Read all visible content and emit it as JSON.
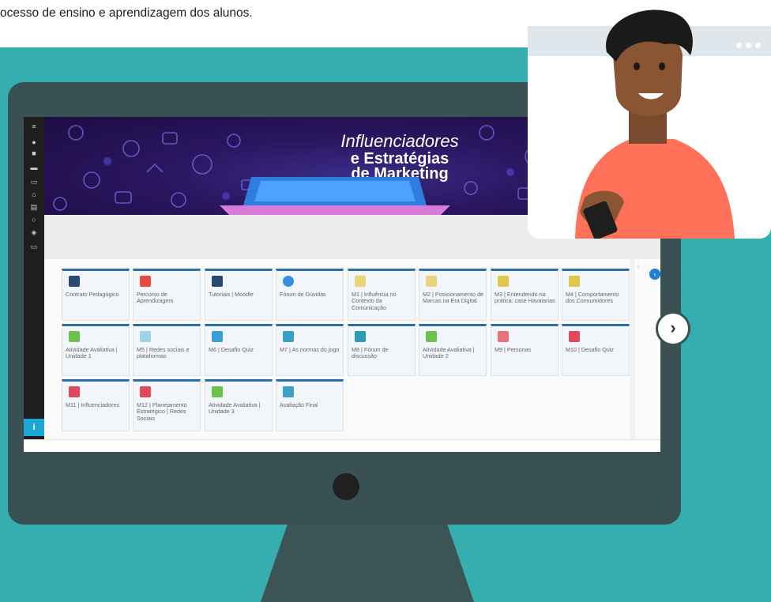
{
  "intro": {
    "text": "ocesso de ensino e aprendizagem dos alunos."
  },
  "banner": {
    "title_line1": "Influenciadores",
    "title_line2": "e Estratégias",
    "title_line3": "de Marketing"
  },
  "courses": [
    {
      "label": "Contrato Pedagógico",
      "color": "#2a4a74"
    },
    {
      "label": "Percurso de Aprendizagem",
      "color": "#e64a3d"
    },
    {
      "label": "Tutoriais | Moodle",
      "color": "#2a4a74"
    },
    {
      "label": "Fórum de Dúvidas",
      "color": "#3a8ee0"
    },
    {
      "label": "M1 | Influência no Contexto da Comunicação",
      "color": "#e8d57a"
    },
    {
      "label": "M2 | Posicionamento de Marcas na Era Digital",
      "color": "#e8d57a"
    },
    {
      "label": "M3 | Entendendo na prática: case Havaianas",
      "color": "#e0c64a"
    },
    {
      "label": "M4 | Comportamento dos Consumidores",
      "color": "#e0c64a"
    },
    {
      "label": "Atividade Avaliativa | Unidade 1",
      "color": "#6cc24a"
    },
    {
      "label": "M5 | Redes sociais e plataformas",
      "color": "#9fd3e6"
    },
    {
      "label": "M6 | Desafio Quiz",
      "color": "#3a9ed8"
    },
    {
      "label": "M7 | As normas do jogo",
      "color": "#3aa0c8"
    },
    {
      "label": "M8 | Fórum de discussão",
      "color": "#2a9bb8"
    },
    {
      "label": "Atividade Avaliativa | Unidade 2",
      "color": "#6cc24a"
    },
    {
      "label": "M9 | Personas",
      "color": "#e8717a"
    },
    {
      "label": "M10 | Desafio Quiz",
      "color": "#e14a5a"
    },
    {
      "label": "M11 | Influenciadores",
      "color": "#e14a5a"
    },
    {
      "label": "M12 | Planejamento Estratégico | Redes Sociais",
      "color": "#e14a5a"
    },
    {
      "label": "Atividade Avaliativa | Unidade 3",
      "color": "#6cc24a"
    },
    {
      "label": "Avaliação Final",
      "color": "#3aa0c8"
    }
  ],
  "nav": {
    "next_icon": "chevron-right-icon",
    "next_glyph": "›"
  },
  "sidebar": {
    "info_glyph": "i"
  }
}
